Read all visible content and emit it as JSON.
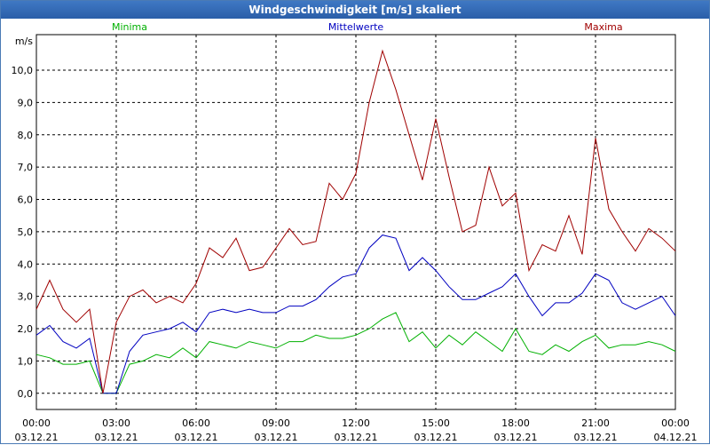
{
  "window": {
    "title": "Windgeschwindigkeit [m/s] skaliert"
  },
  "colors": {
    "minima": "#00b000",
    "mittel": "#0000c0",
    "maxima": "#a00000",
    "title_bg": "#2f67b4"
  },
  "chart_data": {
    "type": "line",
    "title": "Windgeschwindigkeit [m/s] skaliert",
    "ylabel": "m/s",
    "xlabel": "",
    "ylim": [
      -0.5,
      11.1
    ],
    "xlim_hours": [
      0,
      24
    ],
    "grid": true,
    "legend_placement": "top",
    "y_ticks": [
      "0,0",
      "1,0",
      "2,0",
      "3,0",
      "4,0",
      "5,0",
      "6,0",
      "7,0",
      "8,0",
      "9,0",
      "10,0"
    ],
    "x_ticks": [
      {
        "time": "00:00",
        "date": "03.12.21"
      },
      {
        "time": "03:00",
        "date": "03.12.21"
      },
      {
        "time": "06:00",
        "date": "03.12.21"
      },
      {
        "time": "09:00",
        "date": "03.12.21"
      },
      {
        "time": "12:00",
        "date": "03.12.21"
      },
      {
        "time": "15:00",
        "date": "03.12.21"
      },
      {
        "time": "18:00",
        "date": "03.12.21"
      },
      {
        "time": "21:00",
        "date": "03.12.21"
      },
      {
        "time": "00:00",
        "date": "04.12.21"
      }
    ],
    "series": [
      {
        "name": "Minima",
        "color": "#00b000",
        "x": [
          0,
          0.5,
          1,
          1.5,
          2,
          2.5,
          3,
          3.5,
          4,
          4.5,
          5,
          5.5,
          6,
          6.5,
          7,
          7.5,
          8,
          8.5,
          9,
          9.5,
          10,
          10.5,
          11,
          11.5,
          12,
          12.5,
          13,
          13.5,
          14,
          14.5,
          15,
          15.5,
          16,
          16.5,
          17,
          17.5,
          18,
          18.5,
          19,
          19.5,
          20,
          20.5,
          21,
          21.5,
          22,
          22.5,
          23,
          23.5,
          24
        ],
        "y": [
          1.2,
          1.1,
          0.9,
          0.9,
          1.0,
          0.0,
          0.0,
          0.9,
          1.0,
          1.2,
          1.1,
          1.4,
          1.1,
          1.6,
          1.5,
          1.4,
          1.6,
          1.5,
          1.4,
          1.6,
          1.6,
          1.8,
          1.7,
          1.7,
          1.8,
          2.0,
          2.3,
          2.5,
          1.6,
          1.9,
          1.4,
          1.8,
          1.5,
          1.9,
          1.6,
          1.3,
          2.0,
          1.3,
          1.2,
          1.5,
          1.3,
          1.6,
          1.8,
          1.4,
          1.5,
          1.5,
          1.6,
          1.5,
          1.3
        ]
      },
      {
        "name": "Mittelwerte",
        "color": "#0000c0",
        "x": [
          0,
          0.5,
          1,
          1.5,
          2,
          2.5,
          3,
          3.5,
          4,
          4.5,
          5,
          5.5,
          6,
          6.5,
          7,
          7.5,
          8,
          8.5,
          9,
          9.5,
          10,
          10.5,
          11,
          11.5,
          12,
          12.5,
          13,
          13.5,
          14,
          14.5,
          15,
          15.5,
          16,
          16.5,
          17,
          17.5,
          18,
          18.5,
          19,
          19.5,
          20,
          20.5,
          21,
          21.5,
          22,
          22.5,
          23,
          23.5,
          24
        ],
        "y": [
          1.8,
          2.1,
          1.6,
          1.4,
          1.7,
          0.0,
          0.0,
          1.3,
          1.8,
          1.9,
          2.0,
          2.2,
          1.9,
          2.5,
          2.6,
          2.5,
          2.6,
          2.5,
          2.5,
          2.7,
          2.7,
          2.9,
          3.3,
          3.6,
          3.7,
          4.5,
          4.9,
          4.8,
          3.8,
          4.2,
          3.8,
          3.3,
          2.9,
          2.9,
          3.1,
          3.3,
          3.7,
          3.0,
          2.4,
          2.8,
          2.8,
          3.1,
          3.7,
          3.5,
          2.8,
          2.6,
          2.8,
          3.0,
          2.4
        ]
      },
      {
        "name": "Maxima",
        "color": "#a00000",
        "x": [
          0,
          0.5,
          1,
          1.5,
          2,
          2.5,
          3,
          3.5,
          4,
          4.5,
          5,
          5.5,
          6,
          6.5,
          7,
          7.5,
          8,
          8.5,
          9,
          9.5,
          10,
          10.5,
          11,
          11.5,
          12,
          12.5,
          13,
          13.5,
          14,
          14.5,
          15,
          15.5,
          16,
          16.5,
          17,
          17.5,
          18,
          18.5,
          19,
          19.5,
          20,
          20.5,
          21,
          21.5,
          22,
          22.5,
          23,
          23.5,
          24
        ],
        "y": [
          2.6,
          3.5,
          2.6,
          2.2,
          2.6,
          0.0,
          2.2,
          3.0,
          3.2,
          2.8,
          3.0,
          2.8,
          3.4,
          4.5,
          4.2,
          4.8,
          3.8,
          3.9,
          4.5,
          5.1,
          4.6,
          4.7,
          6.5,
          6.0,
          6.8,
          9.0,
          10.6,
          9.4,
          8.0,
          6.6,
          8.5,
          6.7,
          5.0,
          5.2,
          7.0,
          5.8,
          6.2,
          3.8,
          4.6,
          4.4,
          5.5,
          4.3,
          7.9,
          5.7,
          5.0,
          4.4,
          5.1,
          4.8,
          4.4
        ]
      }
    ]
  }
}
